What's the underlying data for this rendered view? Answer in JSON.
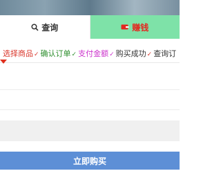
{
  "tabs": {
    "query": {
      "label": "查询",
      "icon": "search-icon"
    },
    "earn": {
      "label": "赚钱",
      "icon": "wallet-icon"
    }
  },
  "steps": [
    {
      "label": "选择商品",
      "color": "#d9362b"
    },
    {
      "label": "确认订单",
      "color": "#2f8f2f"
    },
    {
      "label": "支付金额",
      "color": "#cc33cc"
    },
    {
      "label": "购买成功",
      "color": "#333333"
    },
    {
      "label": "查询订",
      "color": "#333333"
    }
  ],
  "fields": [
    {
      "value": "",
      "placeholder": ""
    },
    {
      "value": "",
      "placeholder": ""
    },
    {
      "value": "",
      "placeholder": ""
    }
  ],
  "buy_button": {
    "label": "立即购买"
  },
  "colors": {
    "earn_tab_bg": "#7ee2a8",
    "earn_tab_text": "#e4261f",
    "button_bg": "#5d8fd6"
  }
}
